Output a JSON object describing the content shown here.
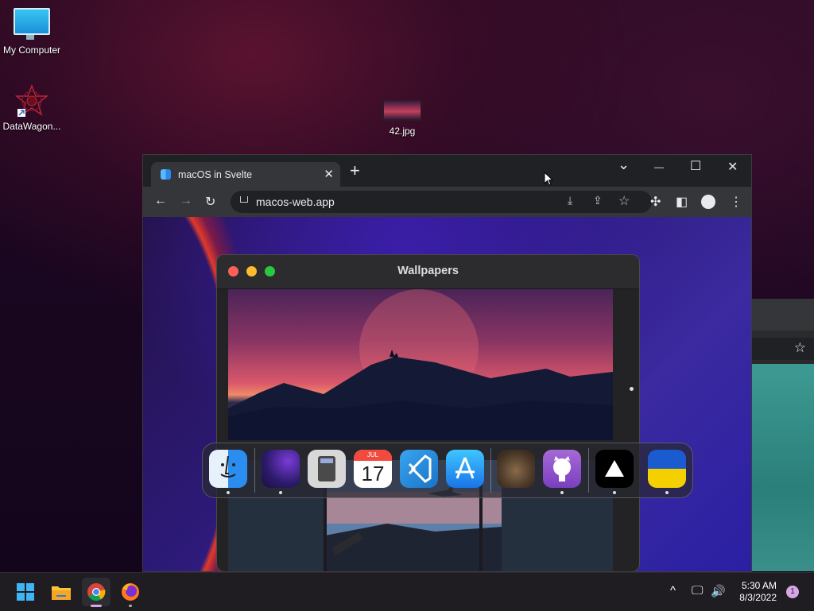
{
  "desktop": {
    "icons": [
      {
        "label": "My Computer"
      },
      {
        "label": "DataWagon..."
      },
      {
        "label": "42.jpg"
      }
    ]
  },
  "browser": {
    "tab_title": "macOS in Svelte",
    "tab_close": "✕",
    "new_tab": "+",
    "url": "macos-web.app",
    "window_controls": {
      "dropdown": "⌄",
      "minimize": "—",
      "maximize": "☐",
      "close": "✕"
    }
  },
  "wallpapers_app": {
    "title": "Wallpapers",
    "traffic_lights": {
      "close": "#ff5f57",
      "minimize": "#febc2e",
      "maximize": "#28c840"
    }
  },
  "dock": {
    "apps": [
      {
        "name": "finder-icon",
        "running": true
      },
      {
        "name": "wallpapers-icon",
        "running": true
      },
      {
        "name": "calculator-icon",
        "running": false
      },
      {
        "name": "calendar-icon",
        "running": false,
        "month": "JUL",
        "day": "17"
      },
      {
        "name": "vscode-icon",
        "running": false
      },
      {
        "name": "appstore-icon",
        "running": false
      },
      {
        "name": "cat-icon",
        "running": false
      },
      {
        "name": "github-icon",
        "running": true
      },
      {
        "name": "vercel-icon",
        "running": true
      },
      {
        "name": "ukraine-flag-icon",
        "running": true
      }
    ]
  },
  "taskbar": {
    "time": "5:30 AM",
    "date": "8/3/2022",
    "notification_count": "1"
  }
}
